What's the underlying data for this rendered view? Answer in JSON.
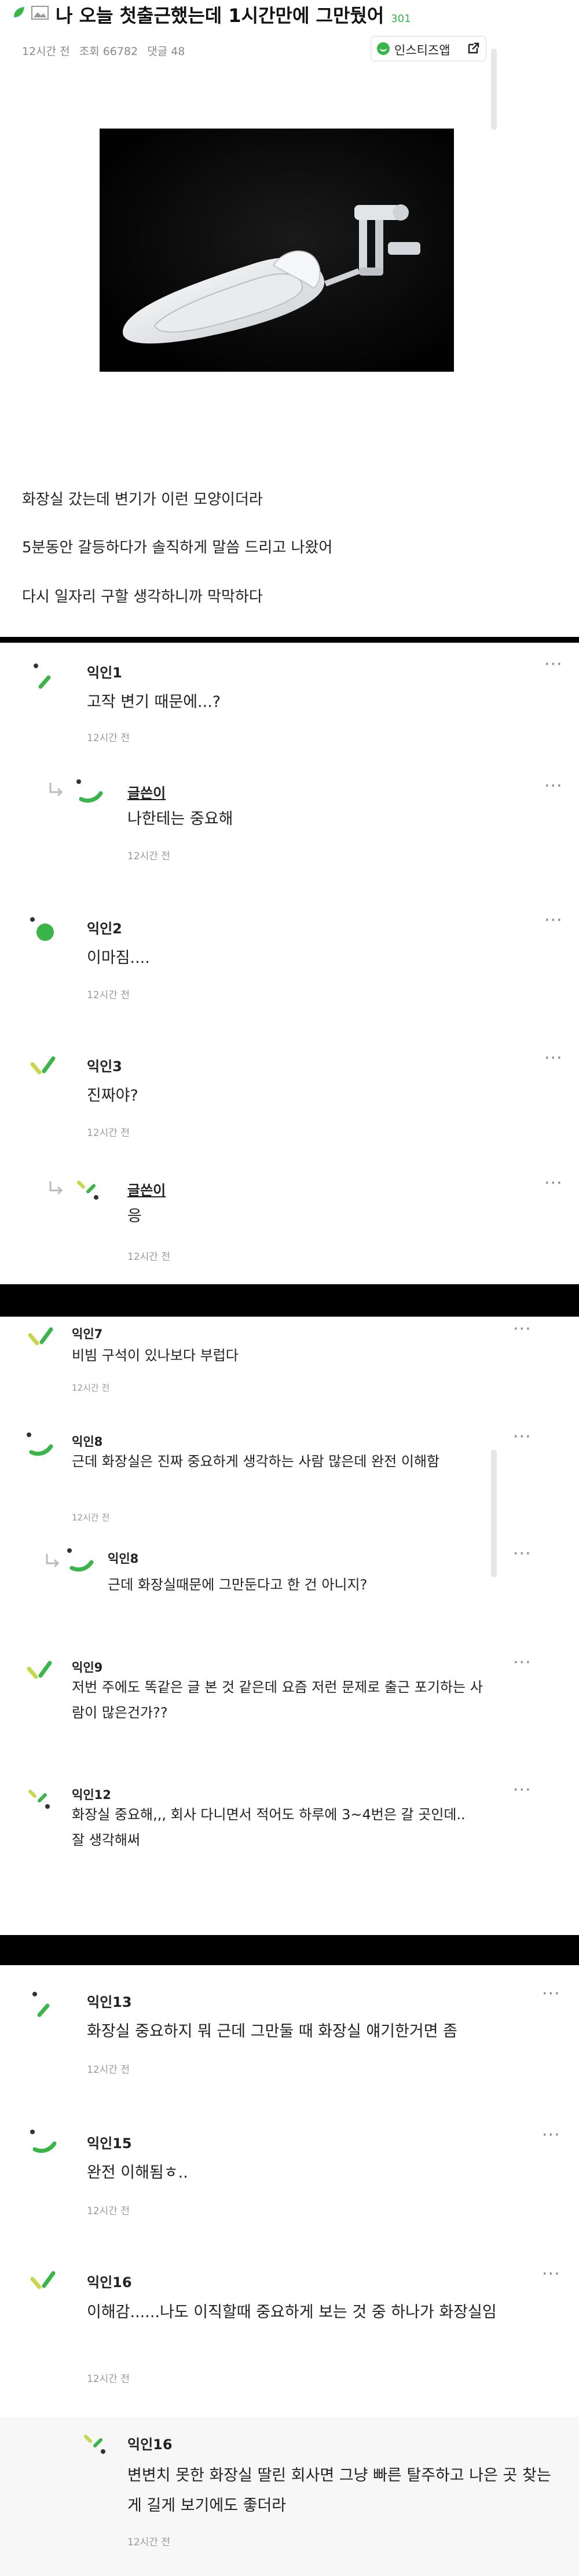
{
  "post": {
    "title": "나 오늘 첫출근했는데 1시간만에 그만뒀어",
    "comment_count": "301",
    "time": "12시간 전",
    "views": "조회 66782",
    "comments": "댓글 48",
    "insta_button": "인스티즈앱",
    "photo_name": "squat toilet",
    "body": [
      "화장실 갔는데 변기가 이런 모양이더라",
      "5분동안 갈등하다가 솔직하게 말씀 드리고 나왔어",
      "다시 일자리 구할 생각하니까 막막하다"
    ]
  },
  "more_icon": "···",
  "colors": {
    "accent": "#39b54a",
    "page_bg": "#000000",
    "panel_bg": "#ffffff"
  },
  "comments": [
    {
      "name": "익인1",
      "text": "고작 변기 때문에...?",
      "time": "12시간 전",
      "icon": "green-dash-icon",
      "reply": false
    },
    {
      "name": "글쓴이",
      "text": "나한테는 중요해",
      "time": "12시간 전",
      "icon": "green-arc-icon",
      "reply": true
    },
    {
      "name": "익인2",
      "text": "이마짐....",
      "time": "12시간 전",
      "icon": "green-circle-icon",
      "reply": false
    },
    {
      "name": "익인3",
      "text": "진짜야?",
      "time": "12시간 전",
      "icon": "green-check-icon",
      "reply": false
    },
    {
      "name": "글쓴이",
      "text": "응",
      "time": "12시간 전",
      "icon": "green-dots-icon",
      "reply": true
    },
    {
      "name": "익인7",
      "text": "비빔 구석이 있나보다 부럽다",
      "time": "12시간 전",
      "icon": "green-check-icon",
      "reply": false
    },
    {
      "name": "익인8",
      "text": "근데 화장실은 진짜 중요하게 생각하는 사람 많은데 완전 이해함",
      "time": "12시간 전",
      "icon": "green-arc-icon",
      "reply": false
    },
    {
      "name": "익인8",
      "text": "근데 화장실때문에 그만둔다고 한 건 아니지?",
      "time": "",
      "icon": "green-arc-icon",
      "reply": true
    },
    {
      "name": "익인9",
      "text": "저번 주에도 똑같은 글 본 것 같은데 요즘 저런 문제로 출근 포기하는 사람이 많은건가??",
      "time": "",
      "icon": "green-check-icon",
      "reply": false
    },
    {
      "name": "익인12",
      "text": "화장실 중요해,,, 회사 다니면서 적어도 하루에 3~4번은 갈 곳인데.. 잘 생각해써",
      "time": "",
      "icon": "green-dots-icon",
      "reply": false
    },
    {
      "name": "익인13",
      "text": "화장실 중요하지 뭐 근데 그만둘 때 화장실 얘기한거면 좀",
      "time": "12시간 전",
      "icon": "green-dash-icon",
      "reply": false
    },
    {
      "name": "익인15",
      "text": "완전 이해됨ㅎ..",
      "time": "12시간 전",
      "icon": "green-arc-icon",
      "reply": false
    },
    {
      "name": "익인16",
      "text": "이해감......나도 이직할때 중요하게 보는 것 중 하나가 화장실임",
      "time": "12시간 전",
      "icon": "green-check-icon",
      "reply": false
    },
    {
      "name": "익인16",
      "text": "변변치 못한 화장실 딸린 회사면 그냥 빠른 탈주하고 나은 곳 찾는게 길게 보기에도 좋더라",
      "time": "12시간 전",
      "icon": "green-dots-icon",
      "reply": true
    }
  ]
}
